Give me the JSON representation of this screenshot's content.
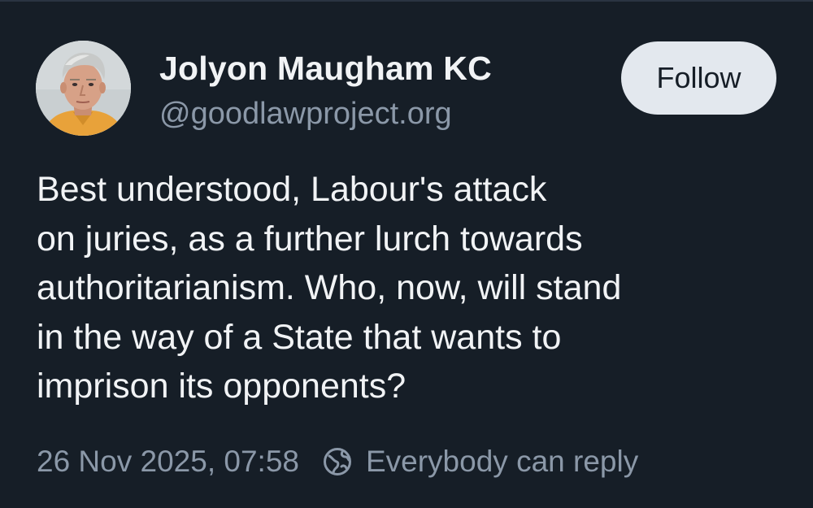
{
  "post": {
    "author": {
      "display_name": "Jolyon Maugham KC",
      "handle": "@goodlawproject.org",
      "avatar_icon": "profile-photo"
    },
    "follow_label": "Follow",
    "text_lines": [
      "Best understood, Labour's attack",
      "on juries, as a further lurch towards",
      "authoritarianism. Who, now, will stand",
      "in the way of a State that wants to",
      "imprison its opponents?"
    ],
    "timestamp": "26 Nov 2025, 07:58",
    "reply_setting": {
      "icon": "globe-icon",
      "label": "Everybody can reply"
    }
  },
  "colors": {
    "background": "#161e27",
    "primary_text": "#f1f3f5",
    "secondary_text": "#8b98a8",
    "follow_button_bg": "#e3e8ee"
  }
}
